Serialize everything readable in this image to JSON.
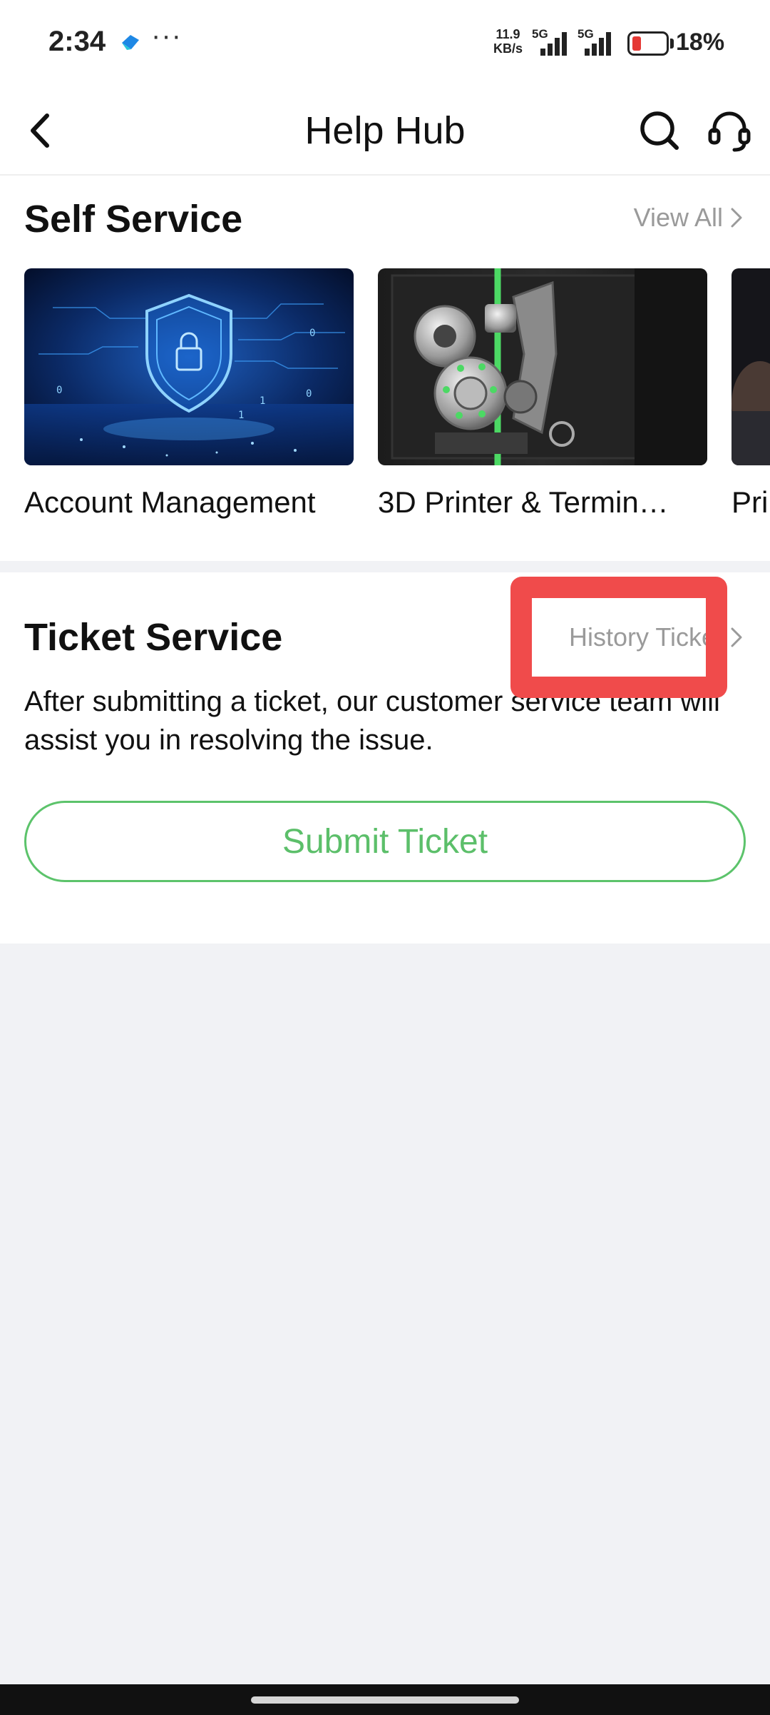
{
  "status_bar": {
    "time": "2:34",
    "dots": "···",
    "speed_value": "11.9",
    "speed_unit": "KB/s",
    "signal1_label": "5G",
    "signal2_label": "5G",
    "battery": "18%"
  },
  "header": {
    "title": "Help Hub"
  },
  "self_service": {
    "title": "Self Service",
    "view_all": "View All",
    "cards": [
      {
        "label": "Account Management"
      },
      {
        "label": "3D Printer & Termin…"
      },
      {
        "label": "Pri"
      }
    ]
  },
  "ticket_service": {
    "title": "Ticket Service",
    "history": "History Ticket",
    "description": "After submitting a ticket, our customer service team will assist you in resolving the issue.",
    "submit": "Submit Ticket"
  },
  "colors": {
    "accent_green": "#5cbf6a",
    "highlight_red": "#f04b4b",
    "muted_text": "#9a9a9a"
  }
}
